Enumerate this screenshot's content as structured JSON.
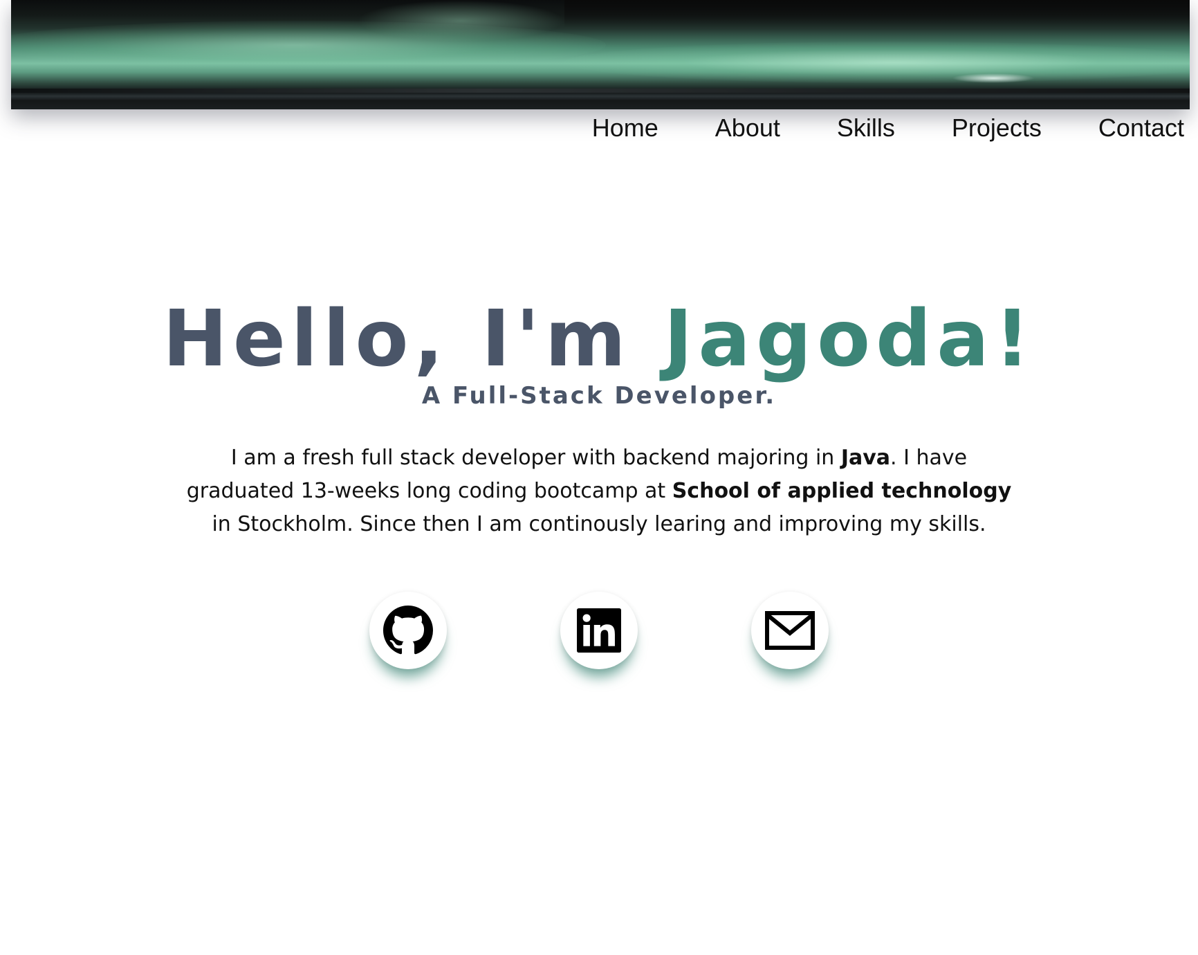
{
  "nav": {
    "items": [
      {
        "label": "Home"
      },
      {
        "label": "About"
      },
      {
        "label": "Skills"
      },
      {
        "label": "Projects"
      },
      {
        "label": "Contact"
      }
    ]
  },
  "hero": {
    "greeting": "Hello, I'm",
    "name": "Jagoda!",
    "subtitle": "A Full-Stack Developer.",
    "bio": {
      "part1": "I am a fresh full stack developer with backend majoring in ",
      "bold1": "Java",
      "part2": ". I have graduated 13-weeks long coding bootcamp at ",
      "bold2": "School of applied technology",
      "part3": " in Stockholm. Since then I am continously learing and improving my skills."
    }
  },
  "socials": [
    {
      "icon": "github-icon"
    },
    {
      "icon": "linkedin-icon"
    },
    {
      "icon": "mail-icon"
    }
  ],
  "colors": {
    "heading": "#4a5568",
    "accent": "#3c8577",
    "text": "#111111"
  }
}
